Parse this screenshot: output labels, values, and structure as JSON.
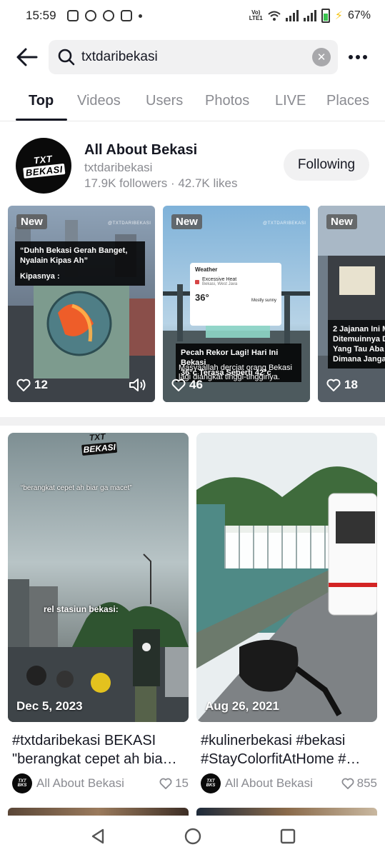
{
  "status_bar": {
    "time": "15:59",
    "network": "VoLTE1",
    "battery": "67%"
  },
  "search": {
    "query": "txtdaribekasi",
    "placeholder": "Search"
  },
  "tabs": [
    {
      "label": "Top",
      "active": true
    },
    {
      "label": "Videos",
      "active": false
    },
    {
      "label": "Users",
      "active": false
    },
    {
      "label": "Photos",
      "active": false
    },
    {
      "label": "LIVE",
      "active": false
    },
    {
      "label": "Places",
      "active": false
    }
  ],
  "user": {
    "avatar_logo_line1": "TXT",
    "avatar_logo_line2": "BEKASI",
    "name": "All About Bekasi",
    "handle": "txtdaribekasi",
    "stats": "17.9K followers · 42.7K likes",
    "follow_label": "Following"
  },
  "user_videos": [
    {
      "badge": "New",
      "caption_line1": "“Duhh Bekasi Gerah Banget,",
      "caption_line2": "Nyalain Kipas Ah”",
      "caption_line3": "Kipasnya :",
      "likes": "12"
    },
    {
      "badge": "New",
      "weather_title": "Weather",
      "weather_alert": "Excessive Heat",
      "weather_place": "Bekasi, West Java",
      "weather_temp": "36°",
      "weather_cond": "Mostly sunny",
      "caption_line1": "Pecah Rekor Lagi! Hari Ini Bekasi",
      "caption_line2": "36°c Terasa Seperti 42°c",
      "sub_line1": "Masyaallah dercjat orang Bekasi",
      "sub_line2": "lagi diangkat tinggi-tingginya.",
      "likes": "46"
    },
    {
      "badge": "New",
      "caption_line1": "2 Jajanan Ini M",
      "caption_line2": "Ditemuinnya D",
      "caption_line3": "Yang Tau Aba",
      "caption_line4": "Dimana Janga",
      "likes": "18"
    }
  ],
  "watermark": "@TXTDARIBEKASI",
  "cards": [
    {
      "overlay_logo_line1": "TXT",
      "overlay_logo_line2": "BEKASI",
      "overlay_text": "“berangkat cepet ah biar ga macet”",
      "overlay_text2": "rel stasiun bekasi:",
      "date": "Dec 5, 2023",
      "title_line1": "#txtdaribekasi BEKASI",
      "title_line2": "\"berangkat cepet ah bia…",
      "author": "All About Bekasi",
      "likes": "15"
    },
    {
      "date": "Aug 26, 2021",
      "title_line1": "#kulinerbekasi #bekasi",
      "title_line2": "#StayColorfitAtHome #…",
      "author": "All About Bekasi",
      "likes": "855"
    }
  ],
  "colors": {
    "text_primary": "#161823",
    "text_secondary": "#8a8b91",
    "pill_bg": "#f1f1f2"
  }
}
